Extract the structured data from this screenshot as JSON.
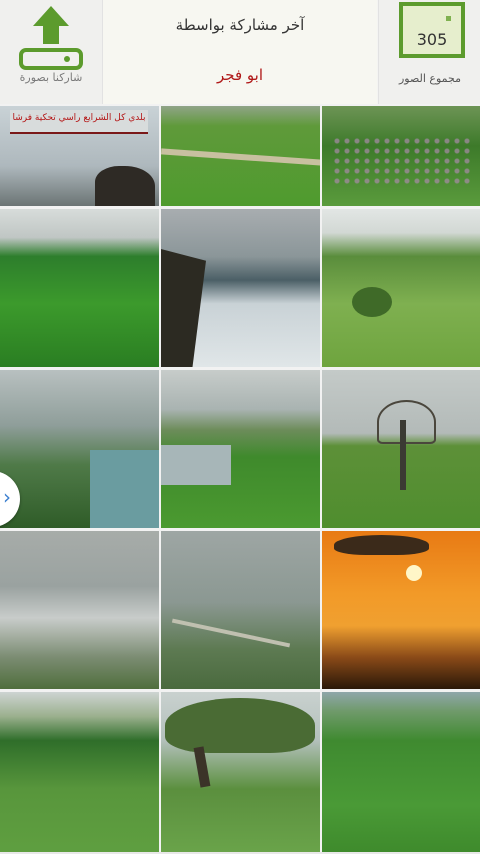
{
  "header": {
    "upload_label": "شاركنا بصورة",
    "last_posted_by_label": "آخر مشاركة بواسطة",
    "last_poster_name": "ابو فجر",
    "photo_count": "305",
    "photo_count_label": "مجموع الصور",
    "accent_color": "#5c9b2d"
  },
  "grid": {
    "tile00_banner": "بلدي كل الشرايع راسي تحكية فرشا"
  },
  "side_button": {
    "glyph": "›"
  }
}
